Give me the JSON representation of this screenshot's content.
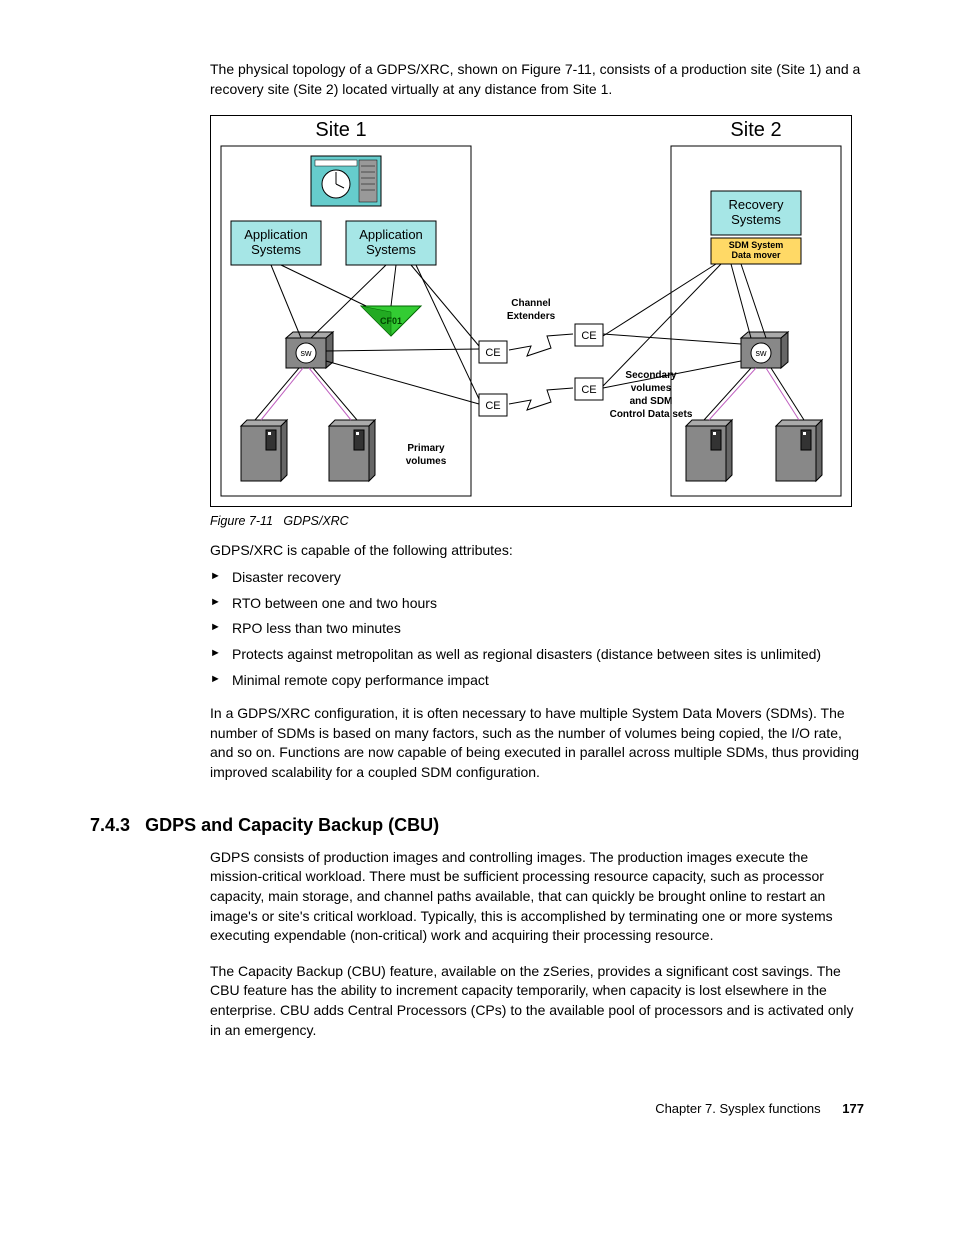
{
  "intro": "The physical topology of a GDPS/XRC, shown on Figure 7-11, consists of a production site (Site 1) and a recovery site (Site 2) located virtually at any distance from Site 1.",
  "figure": {
    "caption_label": "Figure 7-11",
    "caption_text": "GDPS/XRC",
    "site1_title": "Site 1",
    "site2_title": "Site 2",
    "app_sys1": "Application Systems",
    "app_sys2": "Application Systems",
    "recovery_sys": "Recovery Systems",
    "sdm_line1": "SDM System",
    "sdm_line2": "Data mover",
    "cf01": "CF01",
    "sw": "sw",
    "ce": "CE",
    "channel_ext1": "Channel",
    "channel_ext2": "Extenders",
    "primary1": "Primary",
    "primary2": "volumes",
    "secondary1": "Secondary",
    "secondary2": "volumes",
    "secondary3": "and SDM",
    "secondary4": "Control Data sets"
  },
  "attr_lead": "GDPS/XRC is capable of the following attributes:",
  "attributes": [
    "Disaster recovery",
    "RTO between one and two hours",
    "RPO less than two minutes",
    "Protects against metropolitan as well as regional disasters (distance between sites is unlimited)",
    "Minimal remote copy performance impact"
  ],
  "sdm_para": "In a GDPS/XRC configuration, it is often necessary to have multiple System Data Movers (SDMs). The number of SDMs is based on many factors, such as the number of volumes being copied, the I/O rate, and so on. Functions are now capable of being executed in parallel across multiple SDMs, thus providing improved scalability for a coupled SDM configuration.",
  "section": {
    "number": "7.4.3",
    "title": "GDPS and Capacity Backup (CBU)"
  },
  "cbu_para1": "GDPS consists of production images and controlling images. The production images execute the mission-critical workload. There must be sufficient processing resource capacity, such as processor capacity, main storage, and channel paths available, that can quickly be brought online to restart an image's or site's critical workload. Typically, this is accomplished by terminating one or more systems executing expendable (non-critical) work and acquiring their processing resource.",
  "cbu_para2": "The Capacity Backup (CBU) feature, available on the zSeries, provides a significant cost savings. The CBU feature has the ability to increment capacity temporarily, when capacity is lost elsewhere in the enterprise. CBU adds Central Processors (CPs) to the available pool of processors and is activated only in an emergency.",
  "footer_chapter": "Chapter 7. Sysplex functions",
  "footer_page": "177"
}
